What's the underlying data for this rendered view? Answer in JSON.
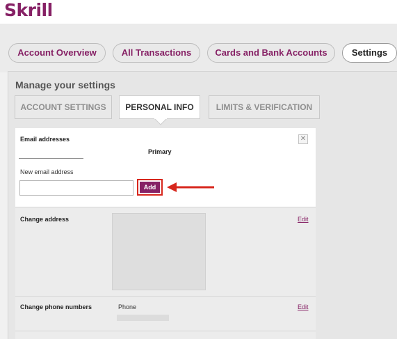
{
  "brand": {
    "logo_text": "Skrill",
    "accent": "#862165"
  },
  "nav": {
    "tabs": [
      {
        "label": "Account Overview",
        "active": false
      },
      {
        "label": "All Transactions",
        "active": false
      },
      {
        "label": "Cards and Bank Accounts",
        "active": false
      },
      {
        "label": "Settings",
        "active": true
      }
    ]
  },
  "settings": {
    "title": "Manage your settings",
    "tabs": [
      {
        "label": "ACCOUNT SETTINGS",
        "active": false
      },
      {
        "label": "PERSONAL INFO",
        "active": true
      },
      {
        "label": "LIMITS & VERIFICATION",
        "active": false
      }
    ]
  },
  "email": {
    "section_label": "Email addresses",
    "primary_label": "Primary",
    "new_label": "New email address",
    "new_value": "",
    "add_label": "Add",
    "close_icon": "close-icon"
  },
  "address": {
    "label": "Change address",
    "edit_label": "Edit"
  },
  "phone": {
    "label": "Change phone numbers",
    "phone_label": "Phone",
    "edit_label": "Edit"
  },
  "annotation": {
    "arrow_color": "#d7271d"
  }
}
